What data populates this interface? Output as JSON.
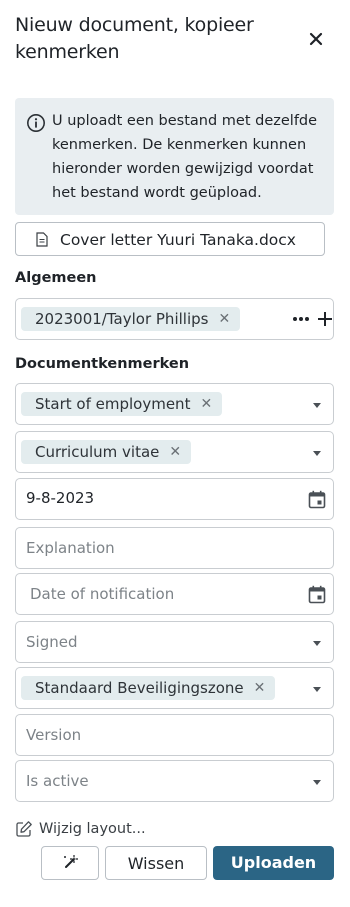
{
  "header": {
    "title": "Nieuw document, kopieer kenmerken"
  },
  "info": {
    "text": "U uploadt een bestand met dezelfde kenmerken. De kenmerken kunnen hieronder worden gewijzigd voordat het bestand wordt geüpload."
  },
  "file": {
    "name": "Cover letter Yuuri Tanaka.docx"
  },
  "general": {
    "label": "Algemeen",
    "chip": "2023001/Taylor Phillips"
  },
  "document_properties": {
    "label": "Documentkenmerken",
    "type_chip": "Start of employment",
    "category_chip": "Curriculum vitae",
    "date_value": "9-8-2023",
    "explanation_placeholder": "Explanation",
    "notification_placeholder": "Date of notification",
    "signed_placeholder": "Signed",
    "security_chip": "Standaard Beveiligingszone",
    "version_placeholder": "Version",
    "active_placeholder": "Is active"
  },
  "footer": {
    "layout_link": "Wijzig layout...",
    "clear_label": "Wissen",
    "upload_label": "Uploaden"
  },
  "colors": {
    "primary": "#2b6585",
    "info_bg": "#e9eef1",
    "chip_bg": "#e3ecee"
  }
}
